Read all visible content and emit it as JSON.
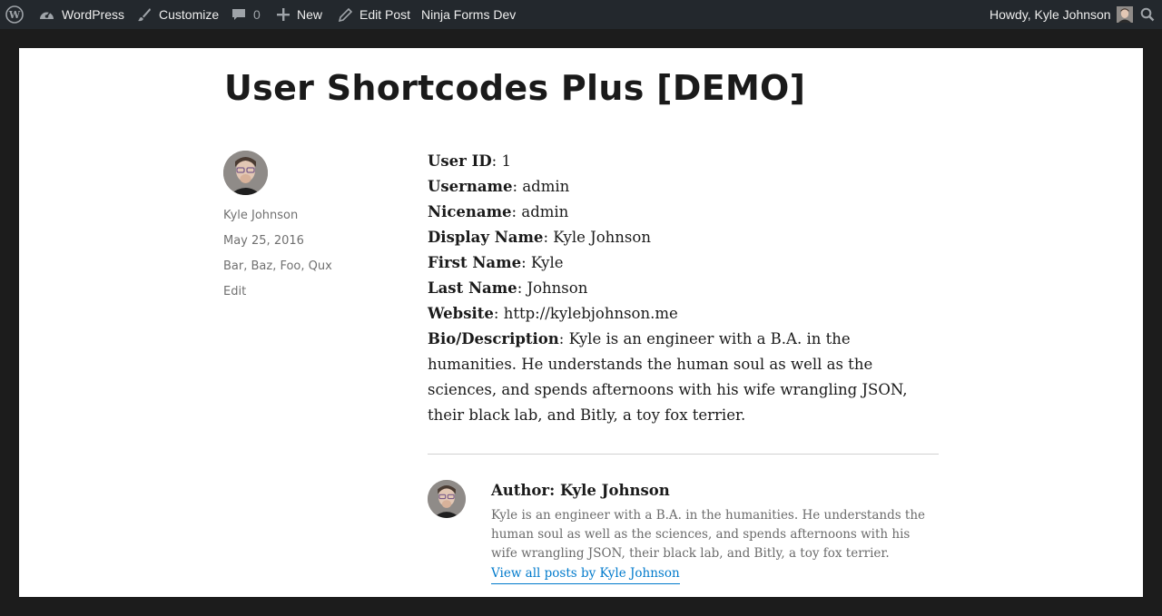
{
  "admin_bar": {
    "site_name": "WordPress",
    "customize": "Customize",
    "comments_count": "0",
    "new_label": "New",
    "edit_post": "Edit Post",
    "site_dev": "Ninja Forms Dev",
    "howdy": "Howdy, Kyle Johnson",
    "icons": [
      "wordpress-logo-icon",
      "dashboard-icon",
      "paintbrush-icon",
      "comment-icon",
      "plus-icon",
      "pencil-icon",
      "search-icon"
    ]
  },
  "post": {
    "title": "User Shortcodes Plus [DEMO]",
    "meta": {
      "author": "Kyle Johnson",
      "date": "May 25, 2016",
      "tags": "Bar, Baz, Foo, Qux",
      "edit": "Edit"
    },
    "fields": [
      {
        "label": "User ID",
        "value": "1"
      },
      {
        "label": "Username",
        "value": "admin"
      },
      {
        "label": "Nicename",
        "value": "admin"
      },
      {
        "label": "Display Name",
        "value": "Kyle Johnson"
      },
      {
        "label": "First Name",
        "value": "Kyle"
      },
      {
        "label": "Last Name",
        "value": "Johnson"
      },
      {
        "label": "Website",
        "value": "http://kylebjohnson.me"
      },
      {
        "label": "Bio/Description",
        "value": "Kyle is an engineer with a B.A. in the humanities. He understands the human soul as well as the sciences, and spends afternoons with his wife wrangling JSON, their black lab, and Bitly, a toy fox terrier."
      }
    ],
    "author_box": {
      "heading": "Author: Kyle Johnson",
      "bio": "Kyle is an engineer with a B.A. in the humanities. He understands the human soul as well as the sciences, and spends afternoons with his wife wrangling JSON, their black lab, and Bitly, a toy fox terrier.",
      "link": "View all posts by Kyle Johnson"
    }
  },
  "colors": {
    "admin_bar_bg": "#23282d",
    "page_bg": "#1c1c1c",
    "card_bg": "#ffffff",
    "link": "#007acc"
  }
}
